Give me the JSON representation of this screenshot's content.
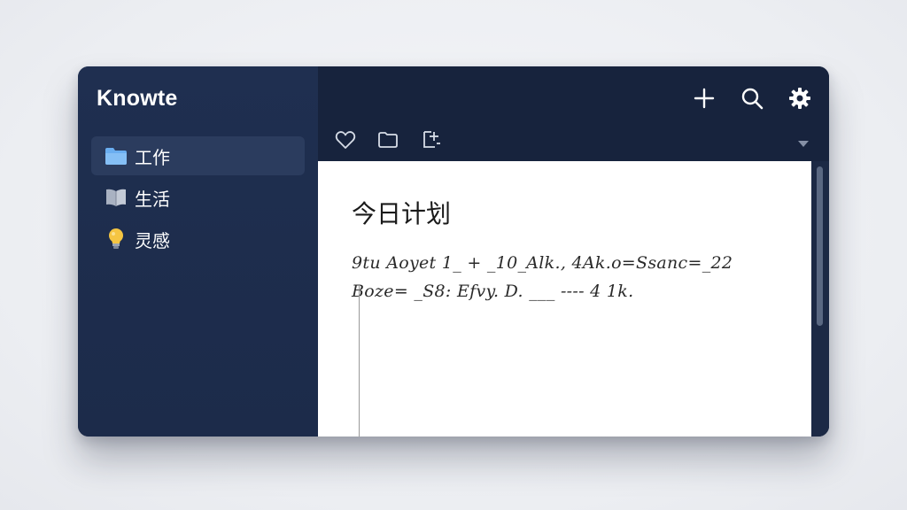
{
  "app": {
    "title": "Knowte"
  },
  "sidebar": {
    "items": [
      {
        "label": "工作",
        "icon": "folder-icon",
        "active": true
      },
      {
        "label": "生活",
        "icon": "book-icon",
        "active": false
      },
      {
        "label": "灵感",
        "icon": "lightbulb-icon",
        "active": false
      }
    ]
  },
  "topbar": {
    "icons": [
      "plus-icon",
      "search-icon",
      "gear-icon"
    ]
  },
  "toolbar": {
    "icons": [
      "heart-icon",
      "folder-icon",
      "crop-icon",
      "chevron-down-icon"
    ]
  },
  "note": {
    "title": "今日计划",
    "lines": [
      "9tu Aoyet 1_ + _10_Alk., 4Ak.o=Ssanc=_22",
      "Boze= _S8: Efvy. D.   ___ ---- 4 1k."
    ]
  },
  "colors": {
    "sidebar_bg": "#1c2b4a",
    "main_bg": "#17233d",
    "active_item": "#2b3c5e",
    "folder": "#6aaef0",
    "bulb": "#f5c542"
  }
}
